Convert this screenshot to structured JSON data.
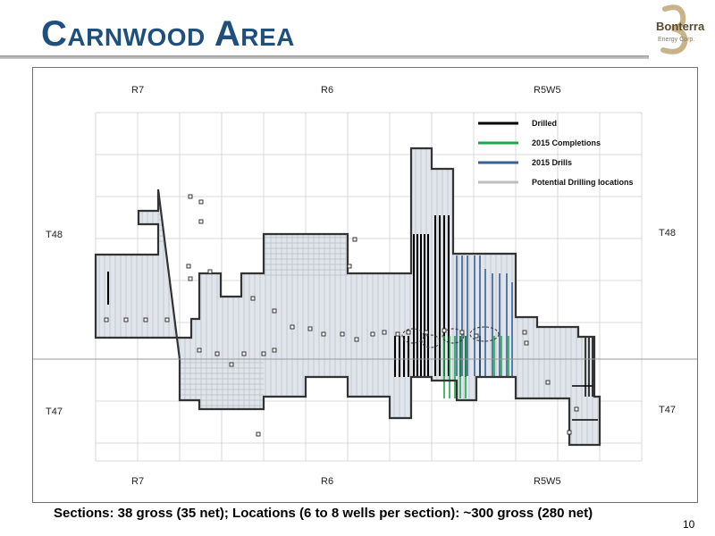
{
  "header": {
    "title": "Carnwood Area",
    "logo_text": "Bonterra",
    "logo_sub": "Energy Corp.",
    "logo_mark": "B"
  },
  "map": {
    "range_labels_top": [
      "R7",
      "R6",
      "R5W5"
    ],
    "range_labels_bottom": [
      "R7",
      "R6",
      "R5W5"
    ],
    "township_labels_left": [
      "T48",
      "T47"
    ],
    "township_labels_right": [
      "T48",
      "T47"
    ],
    "legend": [
      {
        "label": "Drilled",
        "color": "#000000"
      },
      {
        "label": "2015 Completions",
        "color": "#1fa84a"
      },
      {
        "label": "2015 Drills",
        "color": "#3a5f94"
      },
      {
        "label": "Potential Drilling locations",
        "color": "#bdbdbd"
      }
    ],
    "colors": {
      "land_fill": "#dfe5ea",
      "land_outline": "#333333",
      "grid": "#cfcfcf",
      "township_line": "#9a9a9a"
    }
  },
  "footer": {
    "caption": "Sections: 38 gross (35 net); Locations (6 to 8 wells per section): ~300 gross (280 net)",
    "page_number": "10"
  }
}
